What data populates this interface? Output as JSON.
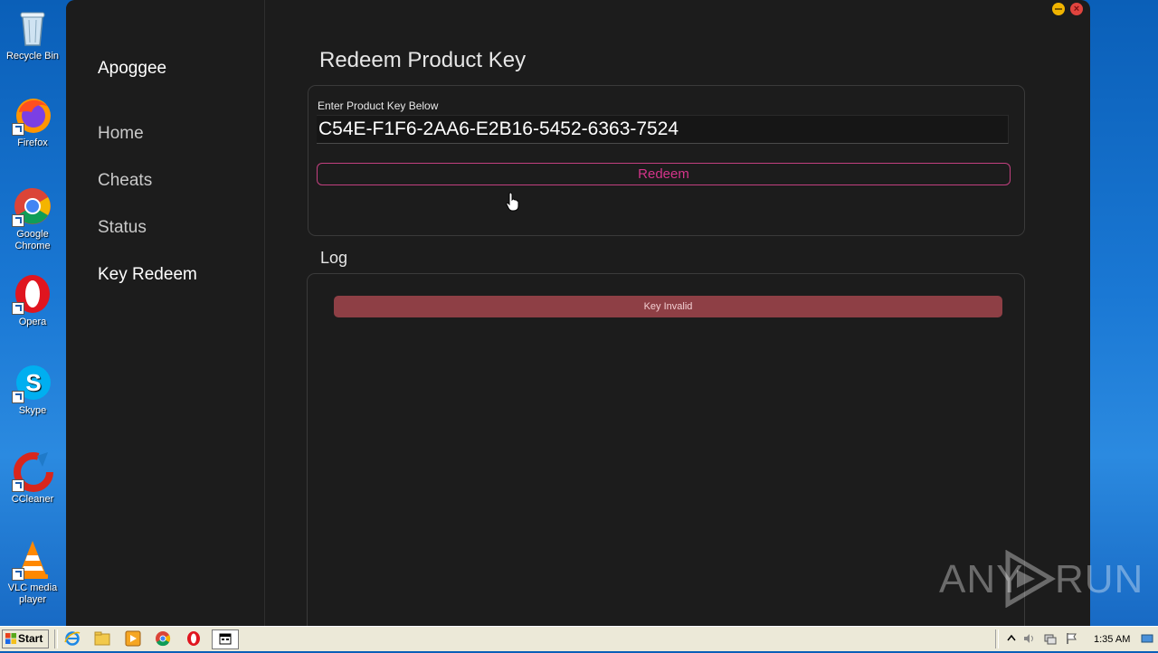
{
  "desktop": {
    "icons": [
      {
        "label": "Recycle Bin"
      },
      {
        "label": "Firefox"
      },
      {
        "label": "Google Chrome"
      },
      {
        "label": "Opera"
      },
      {
        "label": "Skype"
      },
      {
        "label": "CCleaner"
      },
      {
        "label": "VLC media player"
      }
    ]
  },
  "app": {
    "brand": "Apoggee",
    "nav": [
      {
        "label": "Home"
      },
      {
        "label": "Cheats"
      },
      {
        "label": "Status"
      },
      {
        "label": "Key Redeem"
      }
    ],
    "active_nav": "Key Redeem",
    "title": "Redeem Product Key",
    "key_field": {
      "label": "Enter Product Key Below",
      "value": "C54E-F1F6-2AA6-E2B16-5452-6363-7524"
    },
    "redeem_label": "Redeem",
    "log_title": "Log",
    "log_entries": [
      {
        "text": "Key Invalid",
        "status": "error"
      }
    ],
    "colors": {
      "background": "#1c1c1c",
      "accent": "#d4348a",
      "error": "#8e3f45",
      "minimize": "#f0b400",
      "close": "#e0443e"
    }
  },
  "watermark": {
    "left": "ANY",
    "right": "RUN"
  },
  "taskbar": {
    "start_label": "Start",
    "pinned": [
      "ie-icon",
      "explorer-icon",
      "media-player-icon",
      "chrome-icon",
      "opera-icon"
    ],
    "clock": "1:35 AM"
  }
}
